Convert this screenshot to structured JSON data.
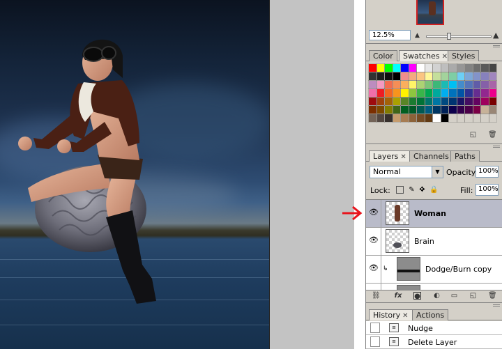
{
  "navigator": {
    "zoom_value": "12.5%",
    "small_mountain_icon": "zoom-out-mountain-icon",
    "large_mountain_icon": "zoom-in-mountain-icon"
  },
  "swatches_panel": {
    "tabs": [
      {
        "label": "Color",
        "active": false,
        "closable": false
      },
      {
        "label": "Swatches",
        "active": true,
        "closable": true
      },
      {
        "label": "Styles",
        "active": false,
        "closable": false
      }
    ],
    "colors": [
      "#ff0000",
      "#ffff00",
      "#00ff00",
      "#00ffff",
      "#0000ff",
      "#ff00ff",
      "#ffffff",
      "#e6e6e6",
      "#d2d2d2",
      "#bebebe",
      "#aaaaaa",
      "#969696",
      "#828282",
      "#6e6e6e",
      "#5a5a5a",
      "#464646",
      "#323232",
      "#1e1e1e",
      "#0f0f0f",
      "#000000",
      "#f08c8c",
      "#f4a981",
      "#fbc582",
      "#fff799",
      "#c4df9b",
      "#a3d39c",
      "#7ecea5",
      "#6ccff6",
      "#7da7d9",
      "#8393ca",
      "#8781bd",
      "#a186be",
      "#bd8cbf",
      "#f49ac1",
      "#f26c4f",
      "#f68e56",
      "#fbaf5d",
      "#fff568",
      "#acd373",
      "#7cc576",
      "#3cb878",
      "#1cbbb4",
      "#00bff3",
      "#448ccb",
      "#5574b9",
      "#605ca8",
      "#8560a8",
      "#a864a8",
      "#f06eaa",
      "#ed1c24",
      "#f26522",
      "#f7941d",
      "#fff200",
      "#8dc63f",
      "#39b54a",
      "#00a651",
      "#00a99d",
      "#00aeef",
      "#0072bc",
      "#0054a6",
      "#2e3192",
      "#662d91",
      "#92278f",
      "#ec008c",
      "#9e0b0f",
      "#a0410d",
      "#a36209",
      "#aba000",
      "#598527",
      "#1a7b30",
      "#007236",
      "#00746b",
      "#0076a3",
      "#004a80",
      "#003471",
      "#1b1464",
      "#440e62",
      "#630460",
      "#9e005d",
      "#790000",
      "#7b2e00",
      "#7d4900",
      "#827b00",
      "#406618",
      "#005e20",
      "#005826",
      "#005952",
      "#005b7f",
      "#003663",
      "#002157",
      "#0d004c",
      "#32004b",
      "#4b0049",
      "#7b0046",
      "#c7b299",
      "#998675",
      "#736357",
      "#534741",
      "#37302d",
      "#c69c6d",
      "#a67c52",
      "#8c6239",
      "#754c24",
      "#603913",
      "#ffffff",
      "#000000",
      "#d4d0c8",
      "#d4d0c8",
      "#d4d0c8",
      "#d4d0c8",
      "#d4d0c8",
      "#d4d0c8"
    ],
    "footer_icons": [
      "new-swatch-icon",
      "trash-icon"
    ]
  },
  "layers_panel": {
    "tabs": [
      {
        "label": "Layers",
        "active": true,
        "closable": true
      },
      {
        "label": "Channels",
        "active": false,
        "closable": false
      },
      {
        "label": "Paths",
        "active": false,
        "closable": false
      }
    ],
    "blend_mode": "Normal",
    "opacity_label": "Opacity:",
    "opacity_value": "100%",
    "lock_label": "Lock:",
    "fill_label": "Fill:",
    "fill_value": "100%",
    "layers": [
      {
        "name": "Woman",
        "selected": true,
        "visible": true
      },
      {
        "name": "Brain",
        "selected": false,
        "visible": true
      },
      {
        "name": "Dodge/Burn copy",
        "selected": false,
        "visible": true
      },
      {
        "name": "",
        "selected": false,
        "visible": true
      }
    ],
    "footer_icons": [
      "link-icon",
      "fx-icon",
      "mask-icon",
      "adjustment-icon",
      "folder-icon",
      "new-layer-icon",
      "trash-icon"
    ],
    "fx_label": "fx"
  },
  "history_panel": {
    "tabs": [
      {
        "label": "History",
        "active": true,
        "closable": true
      },
      {
        "label": "Actions",
        "active": false,
        "closable": false
      }
    ],
    "items": [
      {
        "label": "Nudge"
      },
      {
        "label": "Delete Layer"
      }
    ]
  },
  "colors": {
    "selection_highlight": "#b9bbc9",
    "panel_bg": "#d4d0c8",
    "annotation_arrow": "#e8141c"
  }
}
